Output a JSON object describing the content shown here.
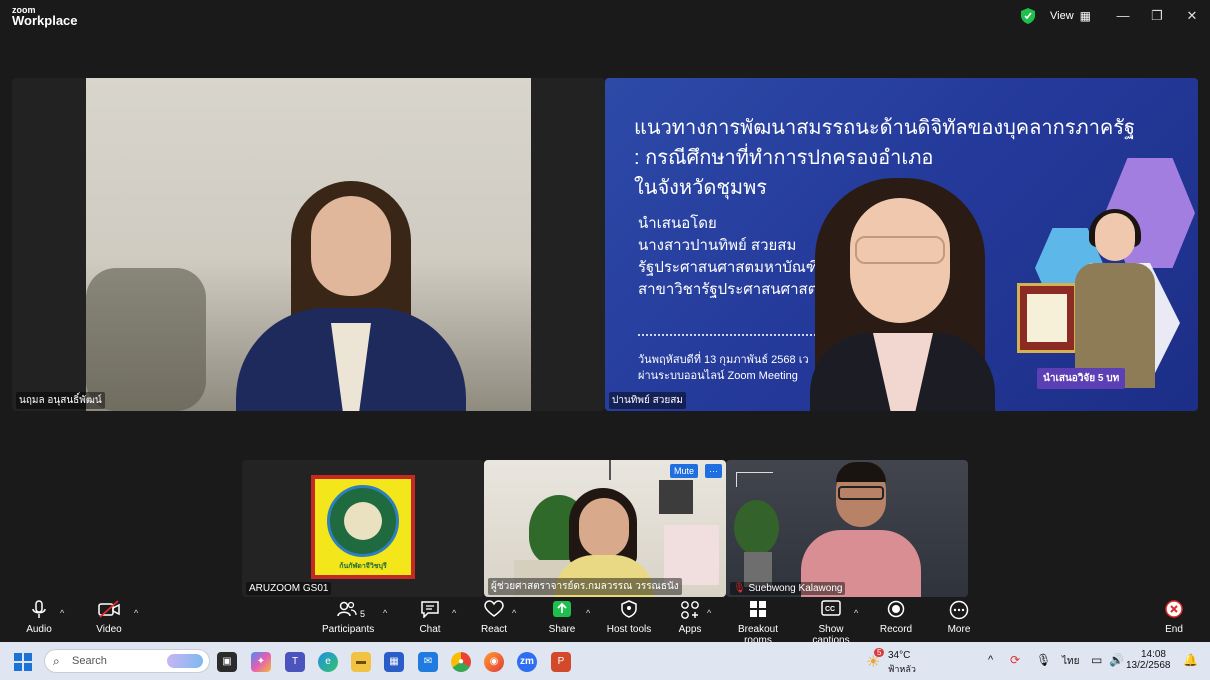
{
  "app": {
    "logo_small": "zoom",
    "logo_big": "Workplace"
  },
  "titlebar": {
    "view_label": "View",
    "minimize": "—",
    "maximize": "❐",
    "close": "✕"
  },
  "tiles": {
    "main_left_name": "นฤมล อนุสนธิ์พัฒน์",
    "main_right_name": "ปานทิพย์ สวยสม",
    "slide": {
      "line1": "แนวทางการพัฒนาสมรรถนะด้านดิจิทัลของบุคลากรภาครัฐ",
      "line2": ": กรณีศึกษาที่ทำการปกครองอำเภอ",
      "line3": "ในจังหวัดชุมพร",
      "sub1": "นำเสนอโดย",
      "sub2": "นางสาวปานทิพย์  สวยสม",
      "sub3": "รัฐประศาสนศาสตมหาบัณฑิต",
      "sub4": "สาขาวิชารัฐประศาสนศาสตร์",
      "foot1": "วันพฤหัสบดีที่ 13 กุมภาพันธ์ 2568 เว",
      "foot2": "ผ่านระบบออนไลน์ Zoom Meeting",
      "badge": "นำเสนอวิจัย 5 บท",
      "logo_text": "ก้นกัฬดาจีวิชบุรี"
    },
    "bottom1_name": "ARUZOOM GS01",
    "bottom2_name": "ผู้ช่วยศาสตราจารย์ดร.กมลวรรณ วรรณธนัง",
    "bottom2_mute": "Mute",
    "bottom2_more": "···",
    "bottom3_name": "Suebwong Kalawong",
    "bottom1_logo_text": "ก้นกัฬดาจีวิชบุรี"
  },
  "controls": {
    "audio": "Audio",
    "video": "Video",
    "participants": "Participants",
    "participants_count": "5",
    "chat": "Chat",
    "react": "React",
    "share": "Share",
    "host_tools": "Host tools",
    "apps": "Apps",
    "breakout": "Breakout rooms",
    "captions": "Show captions",
    "record": "Record",
    "more": "More",
    "end": "End"
  },
  "taskbar": {
    "search_placeholder": "Search",
    "weather_temp": "34°C",
    "weather_desc": "ฟ้าหลัว",
    "weather_badge": "5",
    "lang": "ไทย",
    "time": "14:08",
    "date": "13/2/2568"
  },
  "colors": {
    "accent": "#1f6fe0",
    "end_red": "#e02b2b",
    "share_green": "#1fbf4f",
    "shield_green": "#1fbf4f"
  }
}
